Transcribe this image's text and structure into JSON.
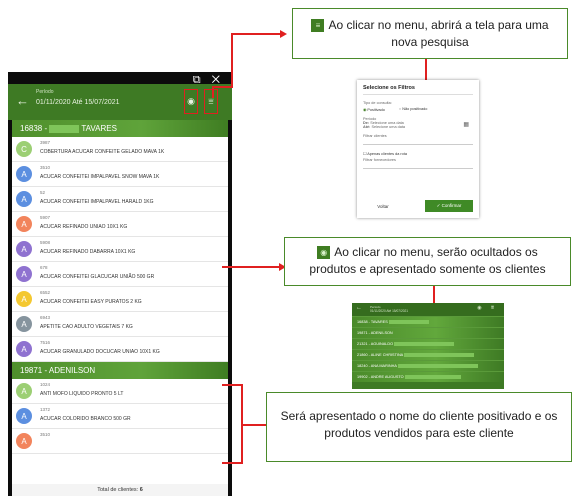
{
  "phone": {
    "window_icons": "⧉ ✕",
    "period_label": "Período",
    "period_value": "01/11/2020 Até 15/07/2021",
    "clients": [
      {
        "header": "16838 -",
        "name_visible": "TAVARES",
        "products": [
          {
            "avatar": "C",
            "color": "#9ccf74",
            "code": "3987",
            "name": "COBERTURA ACUCAR CONFEITE GELADO MAVA 1K"
          },
          {
            "avatar": "A",
            "color": "#5c8fe0",
            "code": "3510",
            "name": "ACUCAR CONFEITEI IMPALPAVEL SNOW MAVA 1K"
          },
          {
            "avatar": "A",
            "color": "#5c8fe0",
            "code": "52",
            "name": "ACUCAR CONFEITEI IMPALPAVEL HARALD 1KG"
          },
          {
            "avatar": "A",
            "color": "#f2845c",
            "code": "5907",
            "name": "ACUCAR REFINADO UNIAO 10X1 KG"
          },
          {
            "avatar": "A",
            "color": "#8f72d0",
            "code": "5908",
            "name": "ACUCAR REFINADO DABARRA 10X1 KG"
          },
          {
            "avatar": "A",
            "color": "#8f72d0",
            "code": "678",
            "name": "ACUCAR CONFEITEI GLACUCAR UNIÃO 500 GR"
          },
          {
            "avatar": "A",
            "color": "#f4c830",
            "code": "6552",
            "name": "ACUCAR CONFEITEI EASY PURATOS 2 KG"
          },
          {
            "avatar": "A",
            "color": "#86949e",
            "code": "6943",
            "name": "APETITE CAO ADULTO VEGETAIS 7 KG"
          },
          {
            "avatar": "A",
            "color": "#8f72d0",
            "code": "7516",
            "name": "ACUCAR GRANULADO DOCUCAR UNIAO 10X1 KG"
          }
        ]
      },
      {
        "header": "19871 - ADENILSON",
        "name_visible": "",
        "products": [
          {
            "avatar": "A",
            "color": "#9ccf74",
            "code": "1024",
            "name": "ANTI MOFO LIQUIDO PRONTO 5 LT"
          },
          {
            "avatar": "A",
            "color": "#5c8fe0",
            "code": "1372",
            "name": "ACUCAR COLORIDO BRANCO 500 GR"
          },
          {
            "avatar": "A",
            "color": "#f2845c",
            "code": "3510",
            "name": ""
          }
        ]
      }
    ],
    "footer_label": "Total de clientes:",
    "footer_value": "6"
  },
  "callouts": {
    "menu_text": "Ao clicar no menu, abrirá a tela para uma nova pesquisa",
    "eye_text": "Ao clicar no menu, serão ocultados os produtos e apresentado somente os clientes",
    "client_text": "Será apresentado o nome do cliente positivado e os produtos vendidos para este cliente"
  },
  "filter_dialog": {
    "title": "Selecione os Filtros",
    "consult_type_label": "Tipo de consulta:",
    "option_positivado": "Positivado",
    "option_nao_positivado": "Não positivado",
    "period_label": "Período",
    "de_label": "De:",
    "de_placeholder": "Selecione uma data",
    "ate_label": "Até:",
    "ate_placeholder": "Selecione uma data",
    "filtrar_clientes": "Filtrar clientes",
    "apenas_rota": "Apenas clientes da rota",
    "filtrar_fornecedores": "Filtrar fornecedores",
    "voltar": "Voltar",
    "confirmar": "Confirmar"
  },
  "clients_only": {
    "period_label": "Período",
    "period_value": "01/11/2020 Até 15/07/2021",
    "rows": [
      {
        "text": "16838 -",
        "extra": "TAVARES"
      },
      {
        "text": "19871 - ADENILSON",
        "extra": ""
      },
      {
        "text": "21321 - AGUINALDO",
        "extra": ""
      },
      {
        "text": "21860 - ALINE CHRISTINA",
        "extra": ""
      },
      {
        "text": "18240 - ANA MARINHA",
        "extra": ""
      },
      {
        "text": "19902 - ANDRE AUGUSTO",
        "extra": ""
      }
    ]
  },
  "colors": {
    "accent": "#3f7d22",
    "connector": "#e02020",
    "callout_border": "#4a8a2a"
  }
}
